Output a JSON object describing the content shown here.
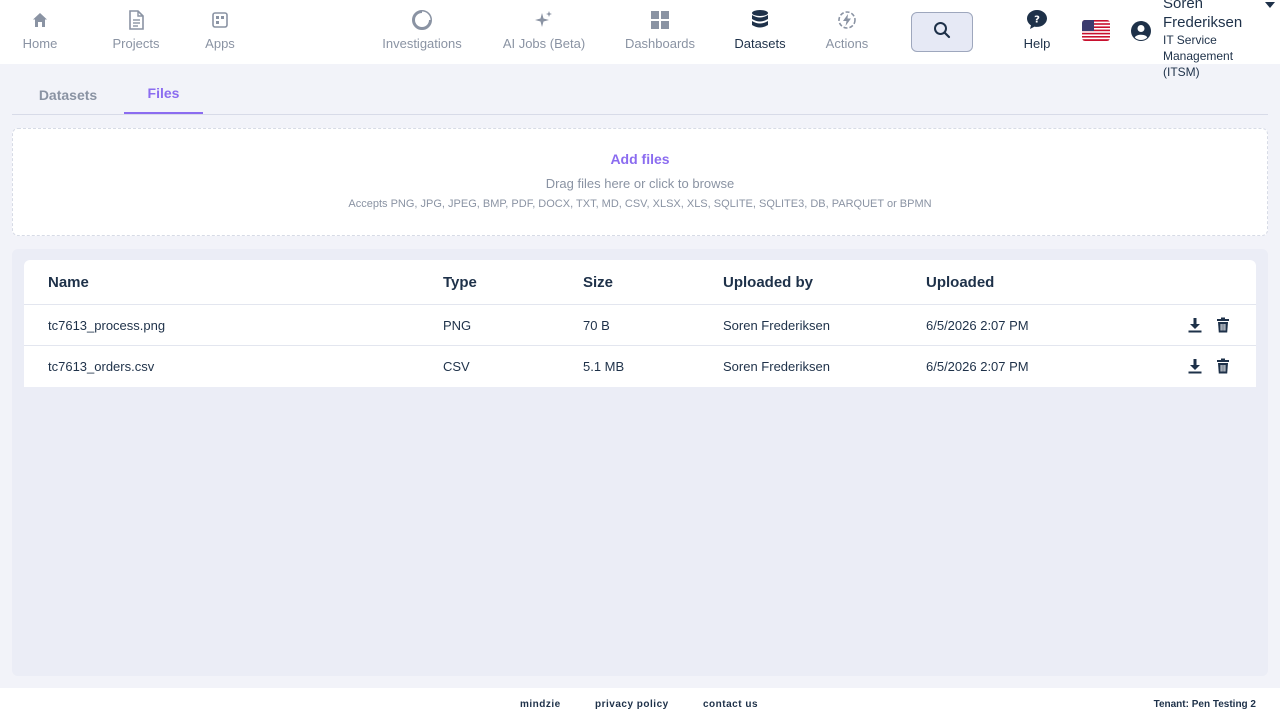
{
  "nav": {
    "home": "Home",
    "projects": "Projects",
    "apps": "Apps",
    "investigations": "Investigations",
    "ai_jobs": "AI Jobs (Beta)",
    "dashboards": "Dashboards",
    "datasets": "Datasets",
    "actions": "Actions",
    "help": "Help",
    "active": "Datasets"
  },
  "user": {
    "name": "Soren Frederiksen",
    "org": "IT Service Management (ITSM)",
    "locale_flag": "us-flag-icon"
  },
  "tabs": {
    "datasets": "Datasets",
    "files": "Files",
    "active": "Files"
  },
  "dropzone": {
    "title": "Add files",
    "subtitle": "Drag files here or click to browse",
    "accepts": "Accepts PNG, JPG, JPEG, BMP, PDF, DOCX, TXT, MD, CSV, XLSX, XLS, SQLITE, SQLITE3, DB, PARQUET or BPMN"
  },
  "table": {
    "columns": [
      "Name",
      "Type",
      "Size",
      "Uploaded by",
      "Uploaded"
    ],
    "rows": [
      {
        "name": "tc7613_process.png",
        "type": "PNG",
        "size": "70 B",
        "uploaded_by": "Soren Frederiksen",
        "uploaded": "6/5/2026 2:07 PM"
      },
      {
        "name": "tc7613_orders.csv",
        "type": "CSV",
        "size": "5.1 MB",
        "uploaded_by": "Soren Frederiksen",
        "uploaded": "6/5/2026 2:07 PM"
      }
    ]
  },
  "footer": {
    "brand": "mindzie",
    "privacy": "privacy policy",
    "contact": "contact us",
    "tenant": "Tenant: Pen Testing 2"
  },
  "colors": {
    "accent": "#8b6cf0",
    "text": "#1e3149",
    "muted": "#8a93a3",
    "background": "#f2f3f9"
  }
}
